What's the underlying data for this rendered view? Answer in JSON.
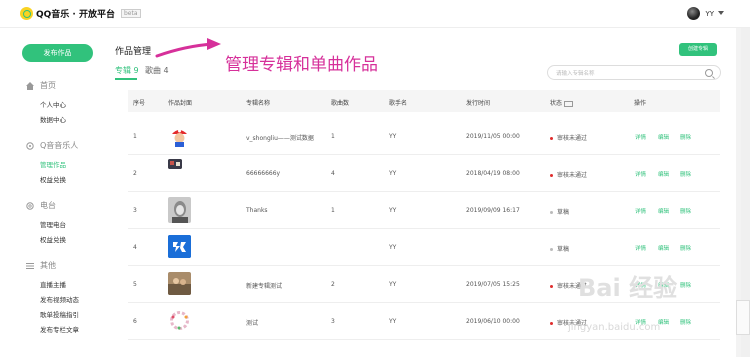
{
  "header": {
    "logo_text": "QQ音乐 · 开放平台",
    "logo_badge": "beta",
    "user_name": "YY"
  },
  "sidebar": {
    "publish_label": "发布作品",
    "groups": [
      {
        "label": "首页",
        "icon": "home-icon",
        "items": [
          "个人中心",
          "数据中心"
        ]
      },
      {
        "label": "Q音音乐人",
        "icon": "music-icon",
        "items": [
          "管理作品",
          "权益兑换"
        ]
      },
      {
        "label": "电台",
        "icon": "radio-icon",
        "items": [
          "管理电台",
          "权益兑换"
        ]
      },
      {
        "label": "其他",
        "icon": "menu-icon",
        "items": [
          "直播主播",
          "发布视频动态",
          "歌单投稿指引",
          "发布专栏文章"
        ]
      }
    ],
    "active_item": "管理作品"
  },
  "main": {
    "page_title": "作品管理",
    "tabs": [
      {
        "label": "专辑 9",
        "active": true
      },
      {
        "label": "歌曲 4",
        "active": false
      }
    ],
    "create_label": "创建专辑",
    "search_placeholder": "请输入专辑名称",
    "annotation": "管理专辑和单曲作品",
    "columns": [
      "序号",
      "作品封面",
      "专辑名称",
      "歌曲数",
      "歌手名",
      "发行时间",
      "状态",
      "操作"
    ],
    "rows": [
      {
        "idx": "1",
        "name": "v_shongliu——测试数据",
        "count": "1",
        "singer": "YY",
        "date": "2019/11/05 00:00",
        "status": "审核未通过",
        "status_color": "#e02d2d",
        "cover": "mario"
      },
      {
        "idx": "2",
        "name": "66666666y",
        "count": "4",
        "singer": "YY",
        "date": "2018/04/19 08:00",
        "status": "审核未通过",
        "status_color": "#e02d2d",
        "cover": "mini"
      },
      {
        "idx": "3",
        "name": "Thanks",
        "count": "1",
        "singer": "YY",
        "date": "2019/09/09 16:17",
        "status": "草稿",
        "status_color": "#bbbbbb",
        "cover": "portrait"
      },
      {
        "idx": "4",
        "name": "",
        "count": "",
        "singer": "YY",
        "date": "",
        "status": "草稿",
        "status_color": "#bbbbbb",
        "cover": "logo"
      },
      {
        "idx": "5",
        "name": "新建专辑测试",
        "count": "2",
        "singer": "YY",
        "date": "2019/07/05 15:25",
        "status": "审核未通过",
        "status_color": "#e02d2d",
        "cover": "photo"
      },
      {
        "idx": "6",
        "name": "测试",
        "count": "3",
        "singer": "YY",
        "date": "2019/06/10 00:00",
        "status": "审核未通过",
        "status_color": "#e02d2d",
        "cover": "wreath"
      }
    ],
    "ops": [
      "详情",
      "编辑",
      "删除"
    ]
  },
  "watermark": {
    "text": "Bai 经验",
    "url": "jingyan.baidu.com"
  },
  "colors": {
    "accent": "#31c27c",
    "annotation": "#d6309a"
  }
}
